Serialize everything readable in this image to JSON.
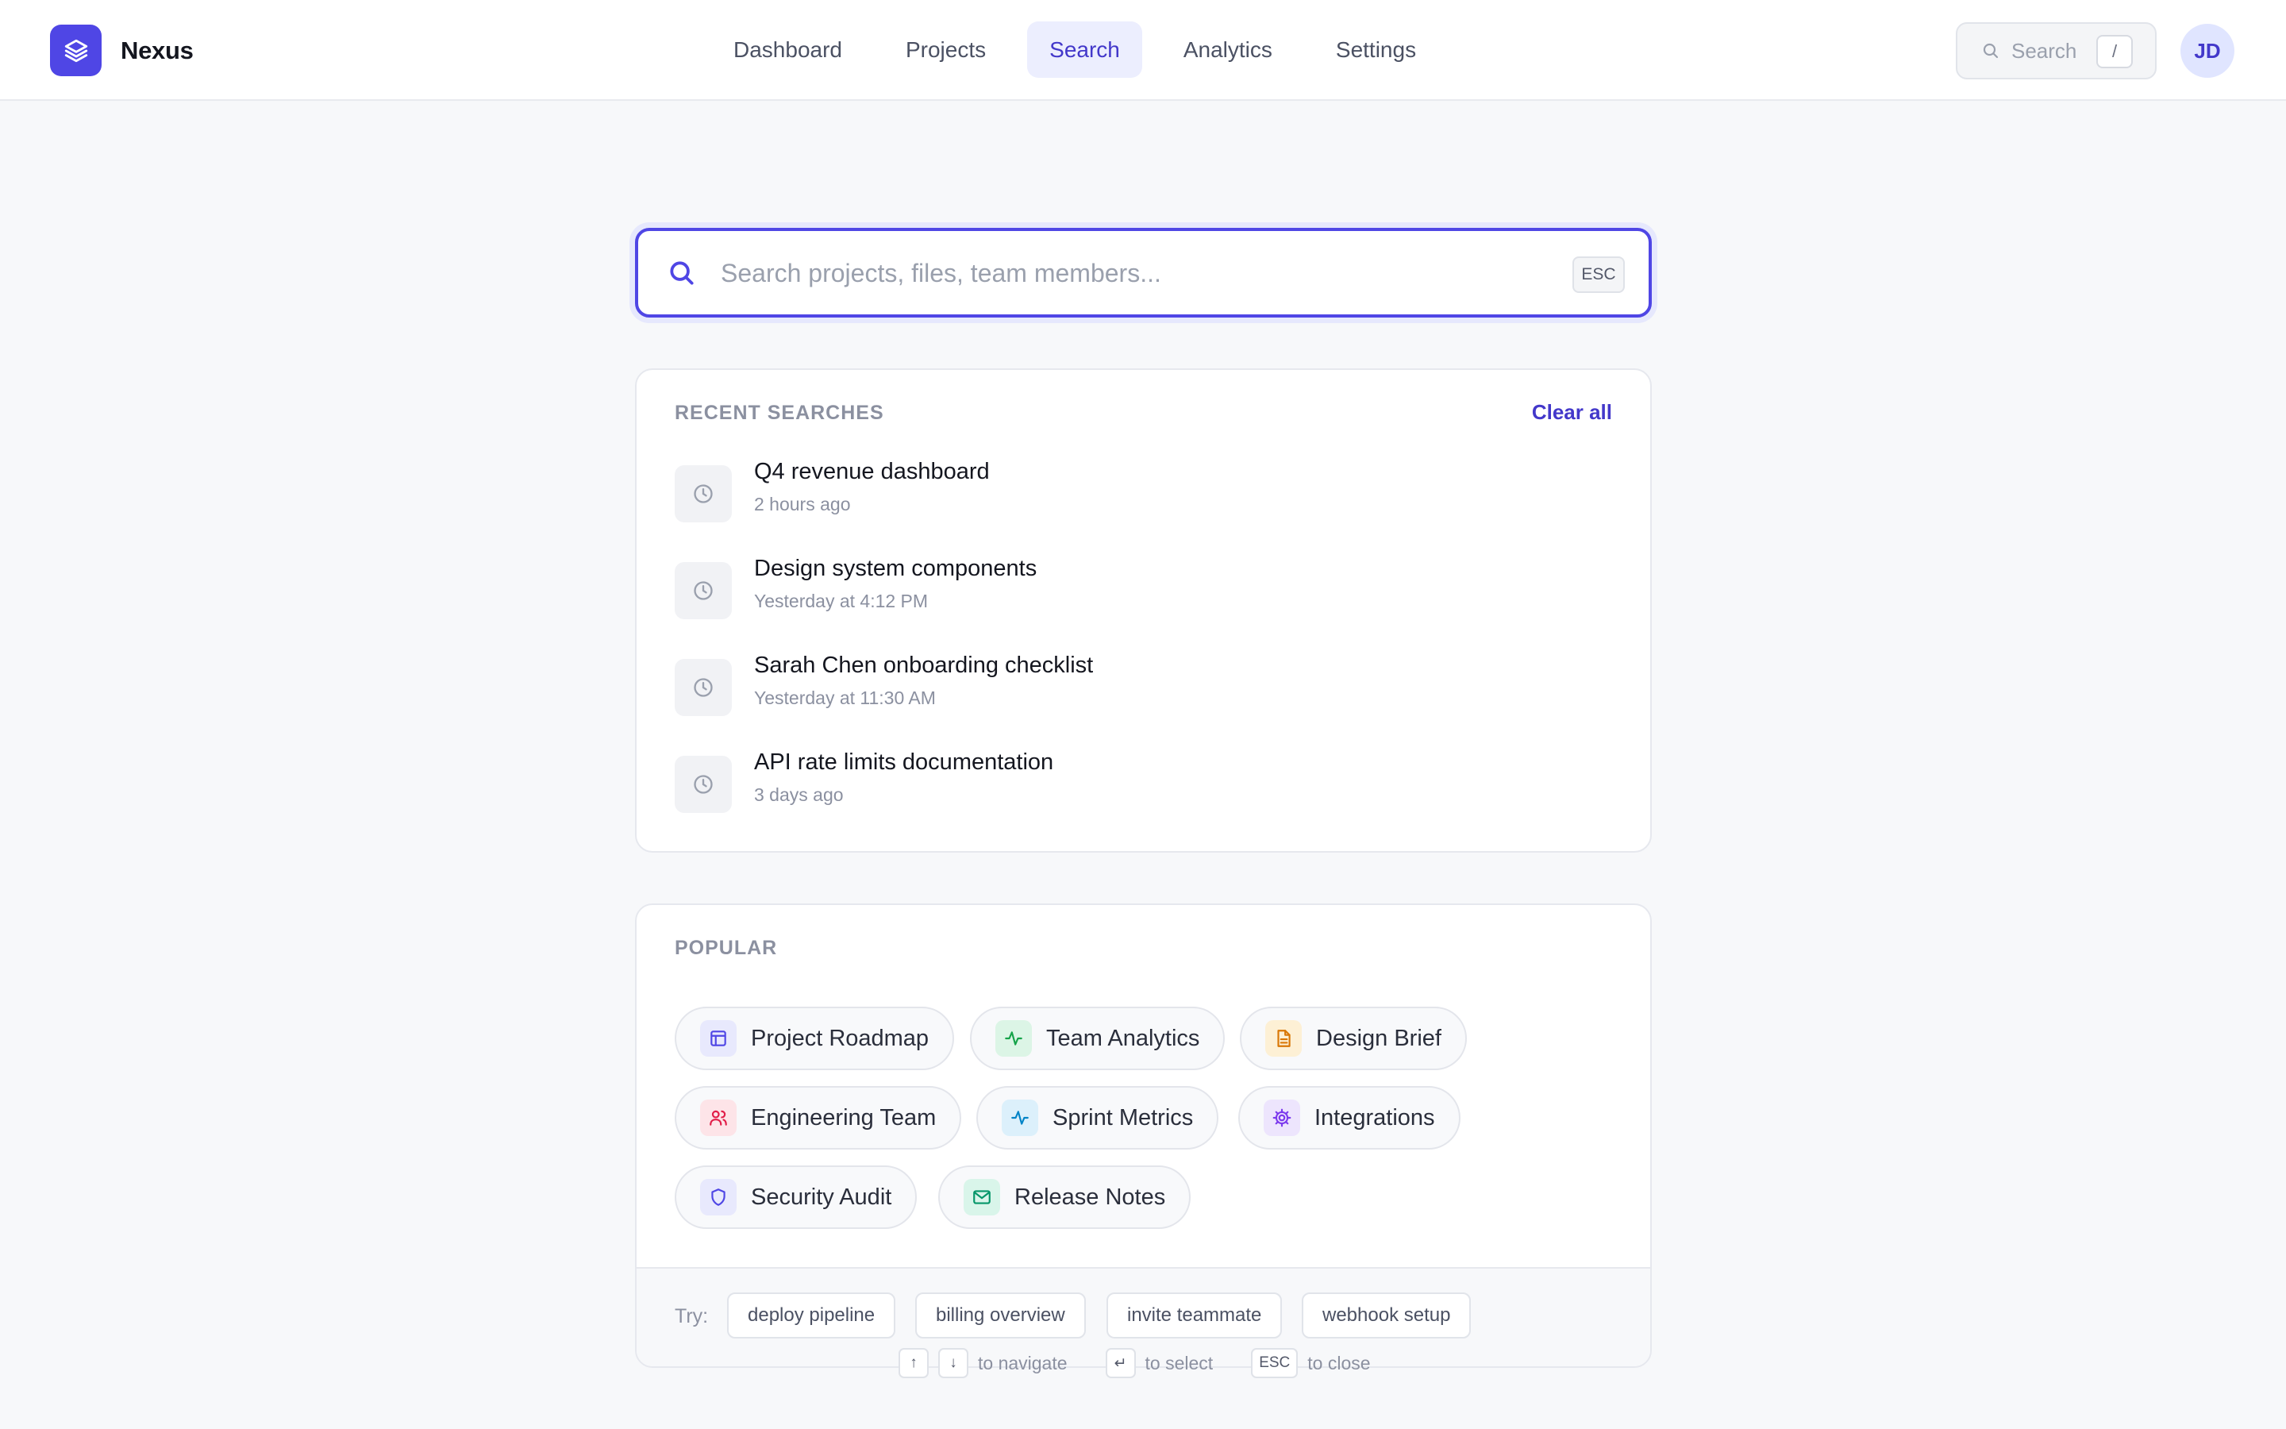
{
  "app": {
    "name": "Nexus",
    "logo_icon": "layers-icon",
    "accent": "#4f46e5"
  },
  "nav": {
    "items": [
      {
        "label": "Dashboard",
        "active": false
      },
      {
        "label": "Projects",
        "active": false
      },
      {
        "label": "Search",
        "active": true
      },
      {
        "label": "Analytics",
        "active": false
      },
      {
        "label": "Settings",
        "active": false
      }
    ]
  },
  "header": {
    "mini_search_label": "Search",
    "mini_search_shortcut": "/",
    "avatar_initials": "JD"
  },
  "search": {
    "placeholder": "Search projects, files, team members...",
    "value": "",
    "esc_label": "ESC"
  },
  "recent": {
    "title": "RECENT SEARCHES",
    "clear_label": "Clear all",
    "items": [
      {
        "title": "Q4 revenue dashboard",
        "time": "2 hours ago",
        "icon": "clock-icon"
      },
      {
        "title": "Design system components",
        "time": "Yesterday at 4:12 PM",
        "icon": "clock-icon"
      },
      {
        "title": "Sarah Chen onboarding checklist",
        "time": "Yesterday at 11:30 AM",
        "icon": "clock-icon"
      },
      {
        "title": "API rate limits documentation",
        "time": "3 days ago",
        "icon": "clock-icon"
      }
    ]
  },
  "popular": {
    "title": "POPULAR",
    "items": [
      {
        "label": "Project Roadmap",
        "icon": "layout-icon",
        "color": "#4f46e5",
        "bg": "#e8e9fd"
      },
      {
        "label": "Team Analytics",
        "icon": "activity-icon",
        "color": "#16a34a",
        "bg": "#dcf5e6"
      },
      {
        "label": "Design Brief",
        "icon": "document-icon",
        "color": "#d97706",
        "bg": "#fdf0d5"
      },
      {
        "label": "Engineering Team",
        "icon": "users-icon",
        "color": "#e11d48",
        "bg": "#fde4e8"
      },
      {
        "label": "Sprint Metrics",
        "icon": "activity-icon",
        "color": "#0284c7",
        "bg": "#dcf0fb"
      },
      {
        "label": "Integrations",
        "icon": "gear-icon",
        "color": "#7c3aed",
        "bg": "#ede5fd"
      },
      {
        "label": "Security Audit",
        "icon": "shield-icon",
        "color": "#4f46e5",
        "bg": "#e8e9fd"
      },
      {
        "label": "Release Notes",
        "icon": "mail-icon",
        "color": "#059669",
        "bg": "#d9f5ea"
      }
    ]
  },
  "suggestions": {
    "label": "Try:",
    "items": [
      "deploy pipeline",
      "billing overview",
      "invite teammate",
      "webhook setup"
    ]
  },
  "hints": {
    "up_key": "↑",
    "down_key": "↓",
    "navigate_text": "to navigate",
    "enter_key": "↵",
    "select_text": "to select",
    "esc_key": "ESC",
    "close_text": "to close"
  }
}
